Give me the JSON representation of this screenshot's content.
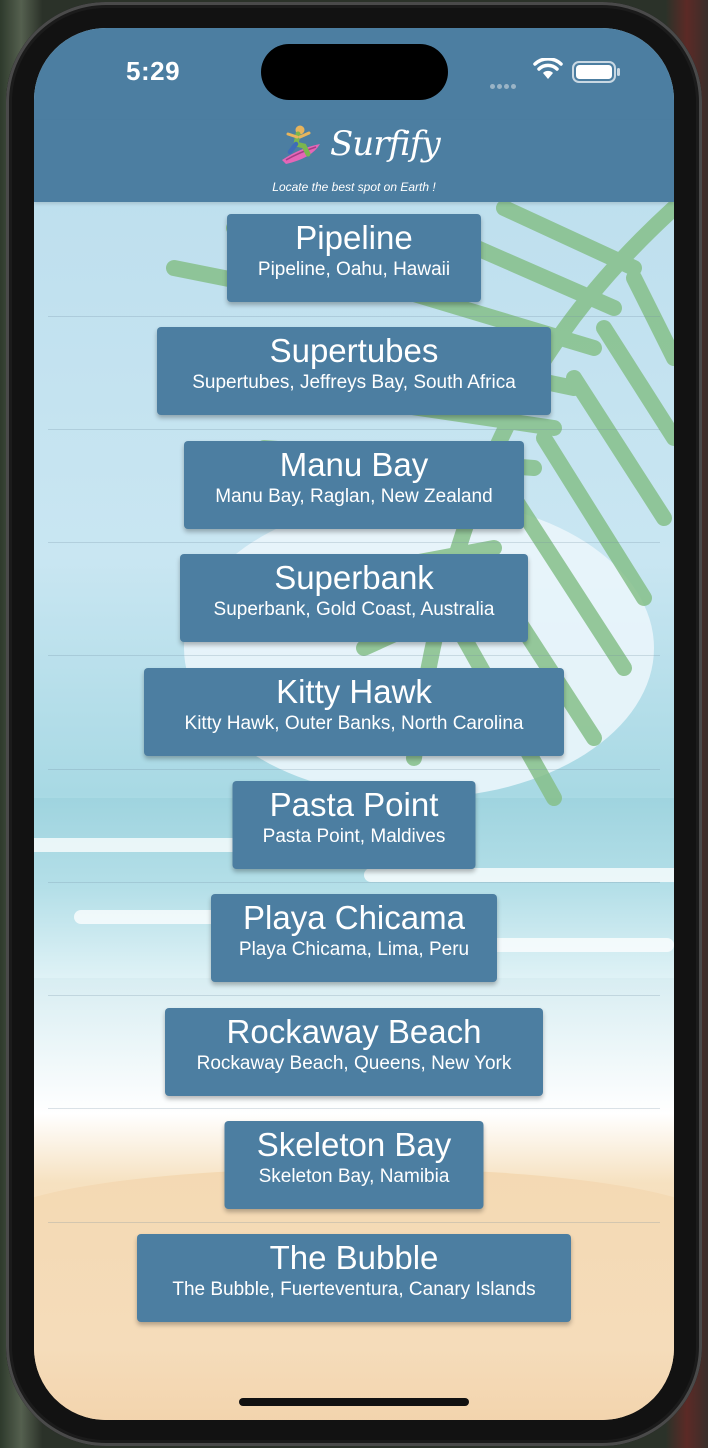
{
  "status_bar": {
    "time": "5:29"
  },
  "header": {
    "brand": "Surfify",
    "tagline": "Locate the best spot on Earth !"
  },
  "spots": [
    {
      "name": "Pipeline",
      "location": "Pipeline, Oahu, Hawaii"
    },
    {
      "name": "Supertubes",
      "location": "Supertubes, Jeffreys Bay, South Africa"
    },
    {
      "name": "Manu Bay",
      "location": "Manu Bay, Raglan, New Zealand"
    },
    {
      "name": "Superbank",
      "location": "Superbank, Gold Coast, Australia"
    },
    {
      "name": "Kitty Hawk",
      "location": "Kitty Hawk, Outer Banks, North Carolina"
    },
    {
      "name": "Pasta Point",
      "location": "Pasta Point, Maldives"
    },
    {
      "name": "Playa Chicama",
      "location": "Playa Chicama, Lima, Peru"
    },
    {
      "name": "Rockaway Beach",
      "location": "Rockaway Beach, Queens, New York"
    },
    {
      "name": "Skeleton Bay",
      "location": "Skeleton Bay, Namibia"
    },
    {
      "name": "The Bubble",
      "location": "The Bubble, Fuerteventura, Canary Islands"
    }
  ],
  "colors": {
    "accent": "#4c7ea1",
    "text": "#ffffff"
  }
}
